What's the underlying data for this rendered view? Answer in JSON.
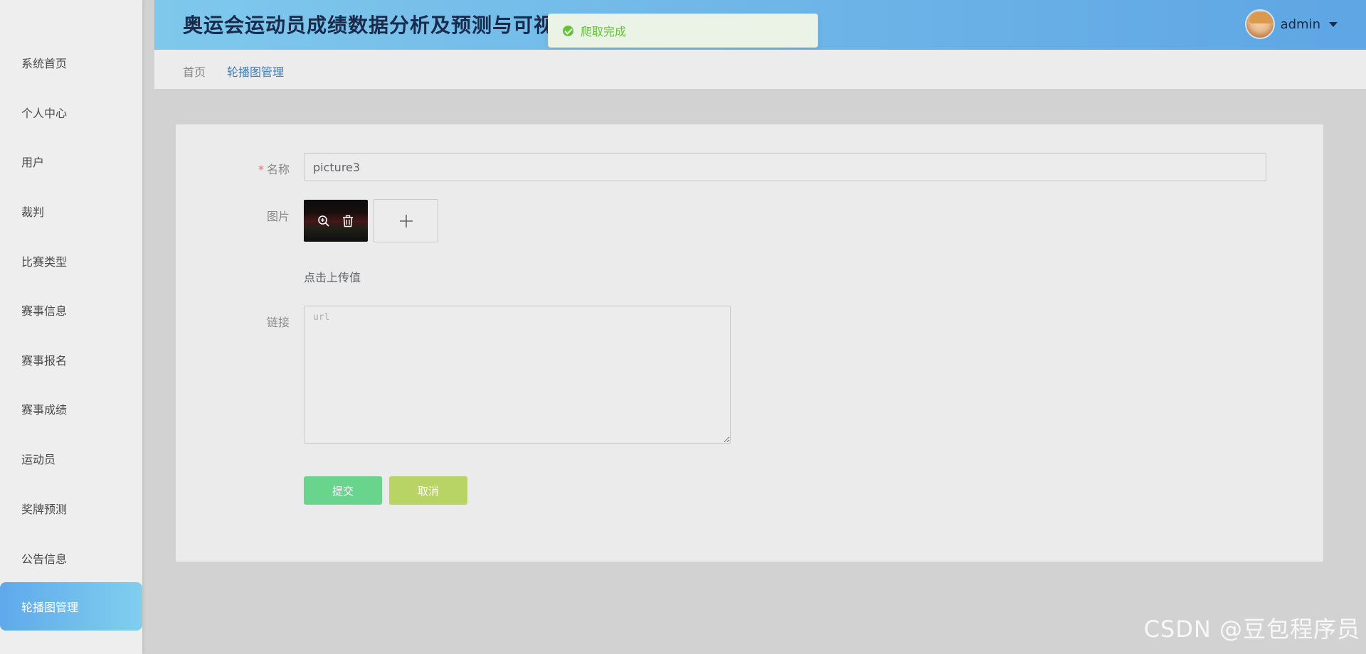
{
  "app": {
    "title": "奥运会运动员成绩数据分析及预测与可视化系统"
  },
  "user": {
    "name": "admin"
  },
  "toast": {
    "message": "爬取完成",
    "type": "success"
  },
  "sidebar": {
    "items": [
      {
        "label": "系统首页"
      },
      {
        "label": "个人中心"
      },
      {
        "label": "用户"
      },
      {
        "label": "裁判"
      },
      {
        "label": "比赛类型"
      },
      {
        "label": "赛事信息"
      },
      {
        "label": "赛事报名"
      },
      {
        "label": "赛事成绩"
      },
      {
        "label": "运动员"
      },
      {
        "label": "奖牌预测"
      },
      {
        "label": "公告信息"
      },
      {
        "label": "轮播图管理",
        "active": true
      }
    ]
  },
  "breadcrumb": {
    "home": "首页",
    "current": "轮播图管理"
  },
  "form": {
    "name_label": "名称",
    "required_mark": "*",
    "name_value": "picture3",
    "image_label": "图片",
    "upload_hint": "点击上传值",
    "link_label": "链接",
    "link_placeholder": "url",
    "link_value": "",
    "submit_label": "提交",
    "cancel_label": "取消"
  },
  "watermark": "CSDN @豆包程序员",
  "colors": {
    "accent": "#5fa9ec",
    "success": "#67c23a",
    "submit": "#68d48c",
    "cancel": "#b8d464",
    "breadcrumb_active": "#3c7ab8"
  }
}
